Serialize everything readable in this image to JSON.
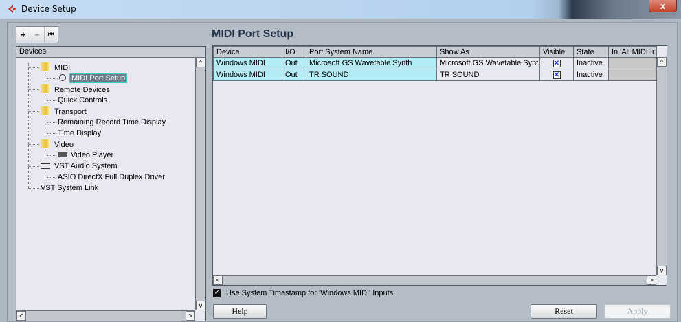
{
  "window": {
    "title": "Device Setup",
    "close_label": "x"
  },
  "toolbar": {
    "add": "+",
    "remove": "−",
    "reset": "⏮"
  },
  "devices": {
    "header": "Devices",
    "items": [
      {
        "label": "MIDI"
      },
      {
        "label": "MIDI Port Setup"
      },
      {
        "label": "Remote Devices"
      },
      {
        "label": "Quick Controls"
      },
      {
        "label": "Transport"
      },
      {
        "label": "Remaining Record Time Display"
      },
      {
        "label": "Time Display"
      },
      {
        "label": "Video"
      },
      {
        "label": "Video Player"
      },
      {
        "label": "VST Audio System"
      },
      {
        "label": "ASIO DirectX Full Duplex Driver"
      },
      {
        "label": "VST System Link"
      }
    ]
  },
  "main": {
    "title": "MIDI Port Setup",
    "columns": [
      "Device",
      "I/O",
      "Port System Name",
      "Show As",
      "Visible",
      "State",
      "In 'All MIDI Ir"
    ],
    "rows": [
      {
        "device": "Windows MIDI",
        "io": "Out",
        "port": "Microsoft GS Wavetable Synth",
        "show_as": "Microsoft GS Wavetable Synth",
        "visible": "✕",
        "state": "Inactive"
      },
      {
        "device": "Windows MIDI",
        "io": "Out",
        "port": "TR SOUND",
        "show_as": "TR SOUND",
        "visible": "✕",
        "state": "Inactive"
      }
    ],
    "timestamp_label": "Use System Timestamp for 'Windows MIDI' Inputs",
    "help": "Help",
    "reset": "Reset",
    "apply": "Apply"
  }
}
